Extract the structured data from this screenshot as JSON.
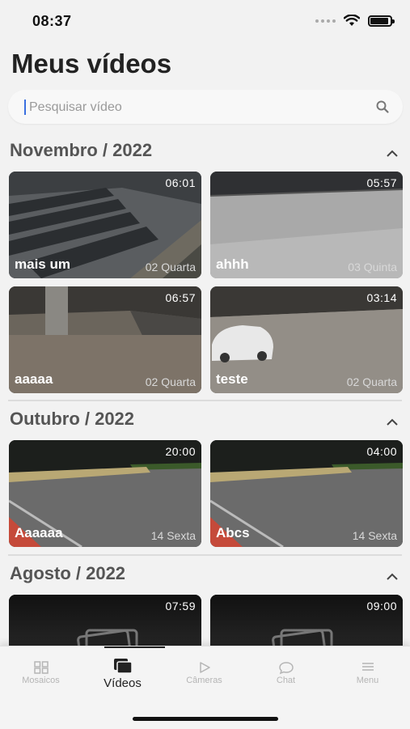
{
  "status_bar": {
    "time": "08:37",
    "battery_level": 0.9
  },
  "header": {
    "title": "Meus vídeos"
  },
  "search": {
    "placeholder": "Pesquisar vídeo",
    "value": ""
  },
  "sections": [
    {
      "title": "Novembro / 2022",
      "videos": [
        {
          "name": "mais um",
          "duration": "06:01",
          "date": "02 Quarta"
        },
        {
          "name": "ahhh",
          "duration": "05:57",
          "date": "03 Quinta"
        },
        {
          "name": "aaaaa",
          "duration": "06:57",
          "date": "02 Quarta"
        },
        {
          "name": "teste",
          "duration": "03:14",
          "date": "02 Quarta"
        }
      ]
    },
    {
      "title": "Outubro / 2022",
      "videos": [
        {
          "name": "Aaaaaa",
          "duration": "20:00",
          "date": "14 Sexta"
        },
        {
          "name": "Abcs",
          "duration": "04:00",
          "date": "14 Sexta"
        }
      ]
    },
    {
      "title": "Agosto / 2022",
      "videos": [
        {
          "name": "",
          "duration": "07:59",
          "date": ""
        },
        {
          "name": "",
          "duration": "09:00",
          "date": ""
        }
      ]
    }
  ],
  "tab_bar": {
    "items": [
      {
        "label": "Mosaicos",
        "icon": "grid-icon",
        "active": false
      },
      {
        "label": "Vídeos",
        "icon": "videos-icon",
        "active": true
      },
      {
        "label": "Câmeras",
        "icon": "play-icon",
        "active": false
      },
      {
        "label": "Chat",
        "icon": "chat-bubble-icon",
        "active": false
      },
      {
        "label": "Menu",
        "icon": "menu-icon",
        "active": false
      }
    ]
  },
  "colors": {
    "background": "#f2f2f2",
    "accent_caret": "#3a6fe0",
    "active_tab": "#222222",
    "inactive_tab": "#b5b5b5"
  }
}
